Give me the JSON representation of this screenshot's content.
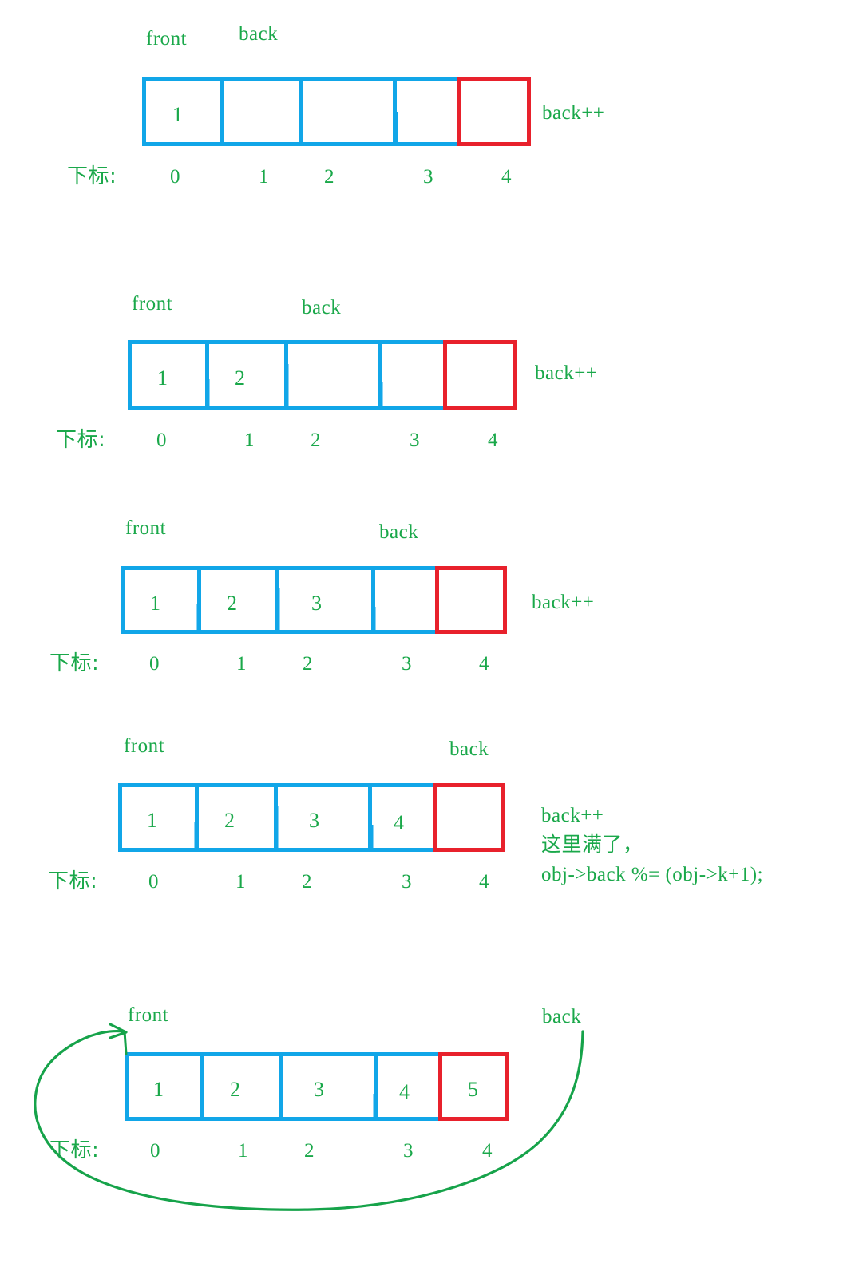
{
  "colors": {
    "blue": "#11a6e8",
    "red": "#e8212c",
    "green": "#1aa84a",
    "background": "#ffffff"
  },
  "diagram": {
    "title": "Circular queue back pointer wrap-around",
    "index_row_label": "下标:",
    "indices": [
      "0",
      "1",
      "2",
      "3",
      "4"
    ],
    "pointer_labels": {
      "front": "front",
      "back": "back"
    }
  },
  "steps": [
    {
      "id": "step-1",
      "front_label": "front",
      "back_label": "back",
      "cells": [
        "1",
        "",
        "",
        "",
        ""
      ],
      "highlight_index": 4,
      "index_label": "下标:",
      "indices": [
        "0",
        "1",
        "2",
        "3",
        "4"
      ],
      "notes": [
        "back++"
      ]
    },
    {
      "id": "step-2",
      "front_label": "front",
      "back_label": "back",
      "cells": [
        "1",
        "2",
        "",
        "",
        ""
      ],
      "highlight_index": 4,
      "index_label": "下标:",
      "indices": [
        "0",
        "1",
        "2",
        "3",
        "4"
      ],
      "notes": [
        "back++"
      ]
    },
    {
      "id": "step-3",
      "front_label": "front",
      "back_label": "back",
      "cells": [
        "1",
        "2",
        "3",
        "",
        ""
      ],
      "highlight_index": 4,
      "index_label": "下标:",
      "indices": [
        "0",
        "1",
        "2",
        "3",
        "4"
      ],
      "notes": [
        "back++"
      ]
    },
    {
      "id": "step-4",
      "front_label": "front",
      "back_label": "back",
      "cells": [
        "1",
        "2",
        "3",
        "4",
        ""
      ],
      "highlight_index": 4,
      "index_label": "下标:",
      "indices": [
        "0",
        "1",
        "2",
        "3",
        "4"
      ],
      "notes": [
        "back++",
        "这里满了，",
        "obj->back %= (obj->k+1);"
      ]
    },
    {
      "id": "step-5",
      "front_label": "front",
      "back_label": "back",
      "cells": [
        "1",
        "2",
        "3",
        "4",
        "5"
      ],
      "highlight_index": 4,
      "index_label": "下标:",
      "indices": [
        "0",
        "1",
        "2",
        "3",
        "4"
      ],
      "notes": [],
      "wrap_arrow": true
    }
  ]
}
